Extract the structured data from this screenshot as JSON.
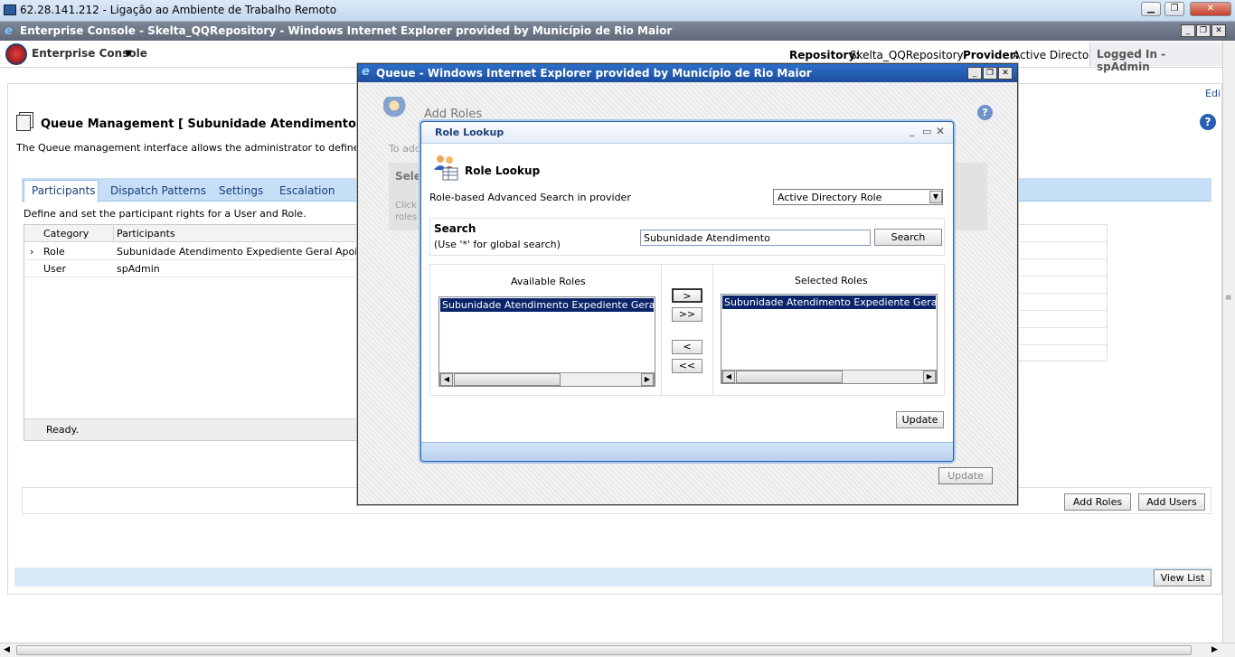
{
  "rdp": {
    "title": "62.28.141.212 - Ligação ao Ambiente de Trabalho Remoto"
  },
  "ie_main": {
    "title": "Enterprise Console - Skelta_QQRepository - Windows Internet Explorer provided by Município de Rio Maior"
  },
  "console": {
    "app_name": "Enterprise Console",
    "repository_label": "Repository:",
    "repository_value": "Skelta_QQRepository",
    "provider_label": "Provider:",
    "provider_value": "Active Directory",
    "logged_in": "Logged In - spAdmin",
    "edit_link": "Edi",
    "page_title": "Queue Management [ Subunidade Atendimento Expedie",
    "description": "The Queue management interface allows the administrator to define the",
    "tabs": [
      "Participants",
      "Dispatch Patterns",
      "Settings",
      "Escalation"
    ],
    "tab_description": "Define and set the participant rights for a User and Role.",
    "grid_headers": [
      "Category",
      "Participants"
    ],
    "grid_rows": [
      {
        "marker": "›",
        "category": "Role",
        "participant": "Subunidade Atendimento Expediente Geral Apoio C"
      },
      {
        "marker": "",
        "category": "User",
        "participant": "spAdmin"
      }
    ],
    "status": "Ready.",
    "add_roles_button": "Add Roles",
    "add_users_button": "Add Users",
    "view_list_button": "View List"
  },
  "queue_popup": {
    "title": "Queue - Windows Internet Explorer provided by Município de Rio Maior",
    "heading": "Add Roles",
    "hint1": "To add",
    "select_label": "Selec",
    "click_text1": "Click",
    "click_text2": "roles",
    "update_button": "Update"
  },
  "role_lookup": {
    "window_title": "Role Lookup",
    "heading": "Role Lookup",
    "provider_label": "Role-based Advanced Search in provider",
    "provider_select": "Active Directory Role",
    "search_label": "Search",
    "search_hint": "(Use '*' for global search)",
    "search_value": "Subunidade Atendimento",
    "search_button": "Search",
    "available_header": "Available Roles",
    "available_items": [
      "Subunidade Atendimento Expediente Geral Ap"
    ],
    "selected_header": "Selected Roles",
    "selected_items": [
      "Subunidade Atendimento Expediente Geral Ap"
    ],
    "move_one_right": ">",
    "move_all_right": ">>",
    "move_one_left": "<",
    "move_all_left": "<<",
    "update_button": "Update"
  },
  "colors": {
    "accent_blue": "#1f4e9e",
    "tab_strip": "#c6dff7",
    "selection": "#0a246a"
  }
}
